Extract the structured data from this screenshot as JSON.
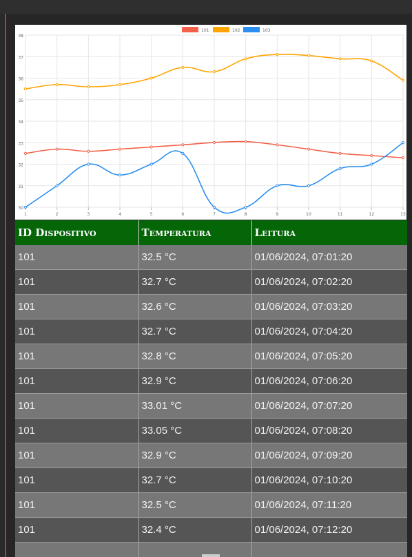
{
  "chart_data": {
    "type": "line",
    "x": [
      1,
      2,
      3,
      4,
      5,
      6,
      7,
      8,
      9,
      10,
      11,
      12,
      13
    ],
    "y_ticks": [
      30,
      31,
      32,
      33,
      34,
      35,
      36,
      37,
      38
    ],
    "ylim": [
      30,
      38
    ],
    "grid": true,
    "legend_position": "top-center",
    "series": [
      {
        "name": "101",
        "color": "#f4604a",
        "values": [
          32.5,
          32.7,
          32.6,
          32.7,
          32.8,
          32.9,
          33.01,
          33.05,
          32.9,
          32.7,
          32.5,
          32.4,
          32.3
        ]
      },
      {
        "name": "102",
        "color": "#ffa400",
        "values": [
          35.5,
          35.7,
          35.6,
          35.7,
          36.0,
          36.5,
          36.3,
          36.9,
          37.1,
          37.05,
          36.9,
          36.8,
          35.9
        ]
      },
      {
        "name": "103",
        "color": "#2a8ff0",
        "values": [
          30.0,
          31.0,
          32.0,
          31.5,
          32.0,
          32.5,
          30.0,
          30.0,
          31.0,
          31.0,
          31.8,
          32.0,
          33.0
        ]
      }
    ]
  },
  "table": {
    "headers": [
      "ID Dispositivo",
      "Temperatura",
      "Leitura"
    ],
    "rows": [
      [
        "101",
        "32.5 °C",
        "01/06/2024, 07:01:20"
      ],
      [
        "101",
        "32.7 °C",
        "01/06/2024, 07:02:20"
      ],
      [
        "101",
        "32.6 °C",
        "01/06/2024, 07:03:20"
      ],
      [
        "101",
        "32.7 °C",
        "01/06/2024, 07:04:20"
      ],
      [
        "101",
        "32.8 °C",
        "01/06/2024, 07:05:20"
      ],
      [
        "101",
        "32.9 °C",
        "01/06/2024, 07:06:20"
      ],
      [
        "101",
        "33.01 °C",
        "01/06/2024, 07:07:20"
      ],
      [
        "101",
        "33.05 °C",
        "01/06/2024, 07:08:20"
      ],
      [
        "101",
        "32.9 °C",
        "01/06/2024, 07:09:20"
      ],
      [
        "101",
        "32.7 °C",
        "01/06/2024, 07:10:20"
      ],
      [
        "101",
        "32.5 °C",
        "01/06/2024, 07:11:20"
      ],
      [
        "101",
        "32.4 °C",
        "01/06/2024, 07:12:20"
      ],
      [
        "",
        "",
        ""
      ]
    ]
  }
}
